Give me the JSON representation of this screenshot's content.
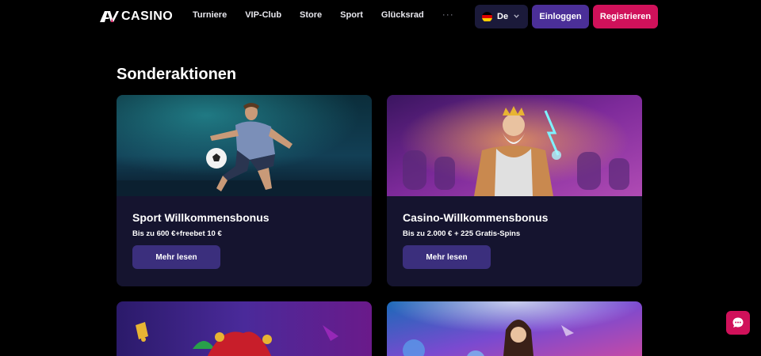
{
  "header": {
    "logo_text": "CASINO",
    "nav": [
      "Turniere",
      "VIP-Club",
      "Store",
      "Sport",
      "Glücksrad"
    ],
    "more": "···",
    "language": "De",
    "login_label": "Einloggen",
    "register_label": "Registrieren"
  },
  "main": {
    "section_title": "Sonderaktionen",
    "cards": [
      {
        "title": "Sport Willkommensbonus",
        "subtitle": "Bis zu 600 €+freebet 10 €",
        "button": "Mehr lesen"
      },
      {
        "title": "Casino-Willkommensbonus",
        "subtitle": "Bis zu 2.000 € + 225 Gratis-Spins",
        "button": "Mehr lesen"
      }
    ]
  },
  "colors": {
    "background": "#000000",
    "card": "#15142f",
    "login": "#4b2f98",
    "register": "#d0115a",
    "card_button": "#3b2f7d",
    "language_pill": "#1b1a3a"
  },
  "icons": [
    "logo-mark-icon",
    "german-flag-icon",
    "chevron-down-icon",
    "chat-icon"
  ]
}
